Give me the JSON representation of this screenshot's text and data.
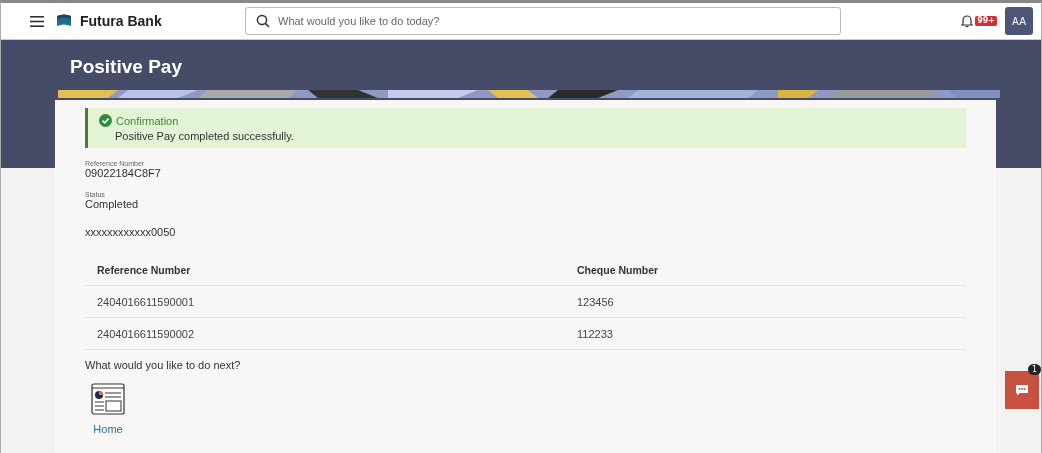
{
  "header": {
    "brand": "Futura Bank",
    "search": {
      "placeholder": "What would you like to do today?"
    },
    "notification_badge": "99+",
    "avatar": "AA"
  },
  "page_title": "Positive Pay",
  "confirmation": {
    "title": "Confirmation",
    "message": "Positive Pay completed successfully."
  },
  "details": [
    {
      "label": "Reference Number",
      "value": "09022184C8F7"
    },
    {
      "label": "Status",
      "value": "Completed"
    }
  ],
  "account": "xxxxxxxxxxxx0050",
  "table": {
    "columns": [
      "Reference Number",
      "Cheque Number"
    ],
    "rows": [
      [
        "2404016611590001",
        "123456"
      ],
      [
        "2404016611590002",
        "112233"
      ]
    ]
  },
  "next_prompt": "What would you like to do next?",
  "next_actions": [
    {
      "label": "Home"
    }
  ],
  "chat_badge": "1"
}
